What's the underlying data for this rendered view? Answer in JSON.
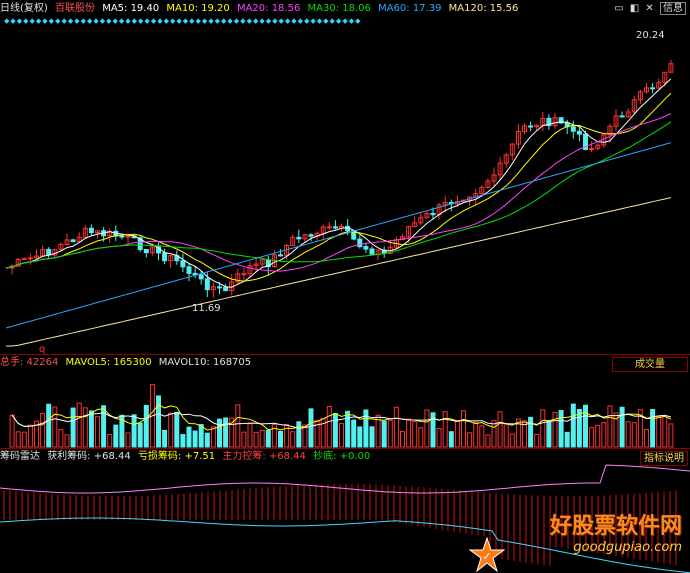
{
  "main_header": {
    "period": "日线(复权)",
    "stock_name": "百联股份",
    "ma5": "MA5: 19.40",
    "ma10": "MA10: 19.20",
    "ma20": "MA20: 18.56",
    "ma30": "MA30: 18.06",
    "ma60": "MA60: 17.39",
    "ma120": "MA120: 15.56",
    "icons": [
      "minimize-icon",
      "restore-icon",
      "close-icon",
      "info-icon"
    ],
    "info_label": "信息"
  },
  "price_labels": {
    "high": "20.24",
    "low": "11.69",
    "marker": "q"
  },
  "vol_header": {
    "name": "总手: 42264",
    "mavol5": "MAVOL5: 165300",
    "mavol10": "MAVOL10: 168705",
    "tab": "成交量"
  },
  "ind_header": {
    "name": "筹码雷达",
    "profit": "获利筹码: +68.44",
    "loss": "亏损筹码: +7.51",
    "main": "主力控筹: +68.44",
    "bottom": "抄底: +0.00",
    "tab": "指标说明"
  },
  "watermark": {
    "title": "好股票软件网",
    "url": "goodgupiao.com"
  },
  "colors": {
    "up": "#ff3030",
    "down": "#54f0f0",
    "ma5": "#ffffff",
    "ma10": "#ffff00",
    "ma20": "#ff40ff",
    "ma30": "#00e000",
    "ma60": "#2aa8ff",
    "ma120": "#ffe8a0"
  }
}
